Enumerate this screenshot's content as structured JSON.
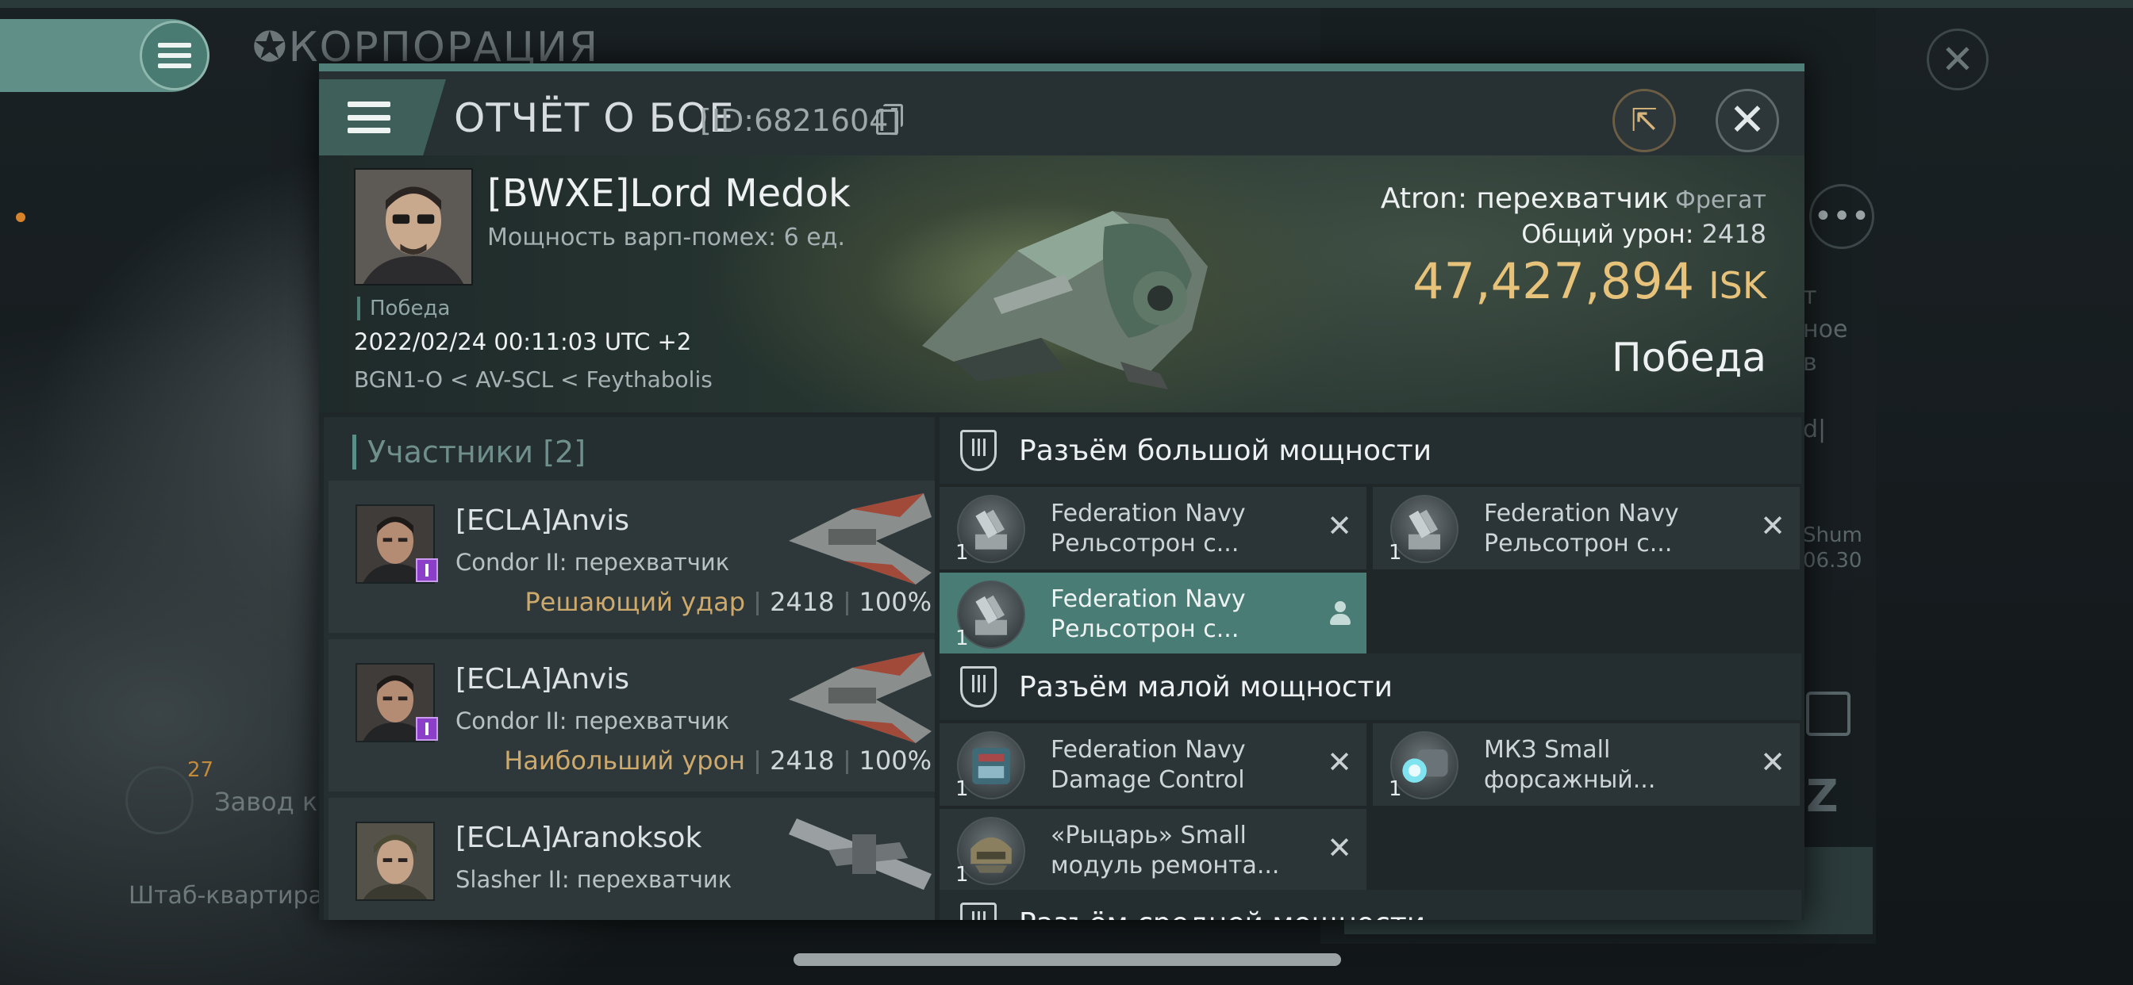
{
  "background": {
    "title": "КОРПОРАЦИЯ",
    "right_texts": [
      "т",
      "ное",
      "в",
      "d|",
      "Shum",
      "06.30"
    ],
    "left_counter": "27",
    "left_label": "Завод к",
    "left_bottom": "Штаб-квартира К"
  },
  "window": {
    "title": "ОТЧЁТ О БОЕ",
    "id_label": "[ID:6821604]",
    "close_symbol": "✕"
  },
  "victim": {
    "name": "[BWXE]Lord Medok",
    "warp": "Мощность варп-помех: 6 ед.",
    "badge": "Победа",
    "datetime": "2022/02/24 00:11:03 UTC +2",
    "location": "BGN1-O < AV-SCL < Feythabolis",
    "ship_name": "Atron: перехватчик",
    "ship_class": "Фрегат",
    "damage_label": "Общий урон:",
    "damage_value": "2418",
    "isk_value": "47,427,894",
    "isk_unit": "ISK",
    "result": "Победа"
  },
  "participants": {
    "header": "Участники [2]",
    "items": [
      {
        "name": "[ECLA]Anvis",
        "ship": "Condor II: перехватчик",
        "tag": "Решающий удар",
        "damage": "2418",
        "percent": "100%"
      },
      {
        "name": "[ECLA]Anvis",
        "ship": "Condor II: перехватчик",
        "tag": "Наибольший урон",
        "damage": "2418",
        "percent": "100%"
      },
      {
        "name": "[ECLA]Aranoksok",
        "ship": "Slasher II: перехватчик"
      }
    ]
  },
  "fittings": {
    "high": {
      "title": "Разъём большой мощности",
      "slots": [
        {
          "qty": "1",
          "line1": "Federation Navy",
          "line2": "Рельсотрон с..."
        },
        {
          "qty": "1",
          "line1": "Federation Navy",
          "line2": "Рельсотрон с..."
        },
        {
          "qty": "1",
          "line1": "Federation Navy",
          "line2": "Рельсотрон с..."
        }
      ]
    },
    "low": {
      "title": "Разъём малой мощности",
      "slots": [
        {
          "qty": "1",
          "line1": "Federation Navy",
          "line2": "Damage Control"
        },
        {
          "qty": "1",
          "line1": "МКЗ Small",
          "line2": "форсажный..."
        },
        {
          "qty": "1",
          "line1": "«Рыцарь» Small",
          "line2": "модуль ремонта..."
        }
      ]
    },
    "next": {
      "title": "Разъём средней мощности"
    }
  },
  "colors": {
    "accent": "#4f7f78",
    "isk": "#e6c27b",
    "tag": "#cda96b",
    "active_slot": "#4a7c76"
  }
}
